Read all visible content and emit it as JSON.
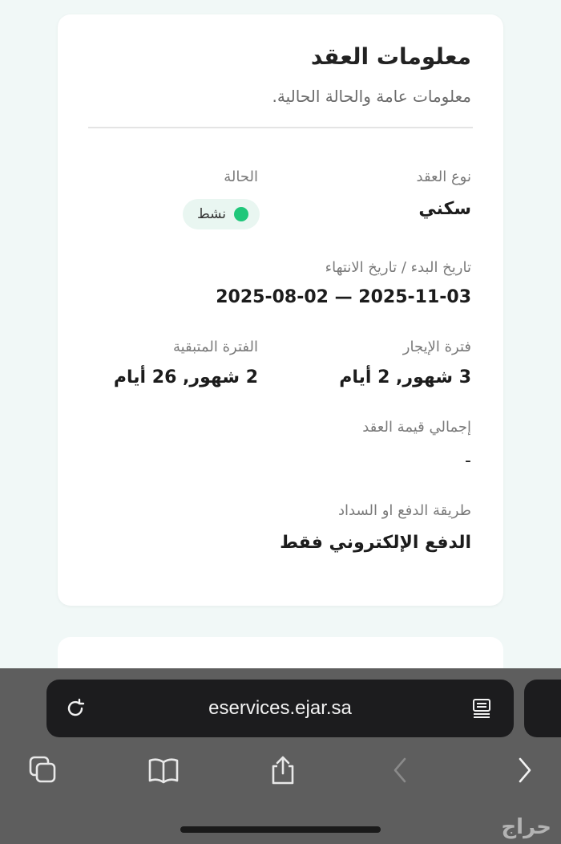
{
  "contract": {
    "title": "معلومات العقد",
    "subtitle": "معلومات عامة والحالة الحالية.",
    "contract_type_label": "نوع العقد",
    "contract_type_value": "سكني",
    "status_label": "الحالة",
    "status_value": "نشط",
    "dates_label": "تاريخ البدء / تاريخ الانتهاء",
    "dates_value": "2025-08-02 — 2025-11-03",
    "lease_period_label": "فترة الإيجار",
    "lease_period_value": "3 شهور, 2 أيام",
    "remaining_period_label": "الفترة المتبقية",
    "remaining_period_value": "2 شهور, 26 أيام",
    "total_value_label": "إجمالي قيمة العقد",
    "total_value_value": "-",
    "payment_method_label": "طريقة الدفع او السداد",
    "payment_method_value": "الدفع الإلكتروني فقط"
  },
  "browser": {
    "url": "eservices.ejar.sa"
  },
  "watermark": "حراج",
  "colors": {
    "status_active": "#1fc77a",
    "status_badge_bg": "#e9f6f1",
    "page_bg": "#f1f8f7"
  },
  "icons": {
    "reload": "reload-icon",
    "reader": "reader-mode-icon",
    "tabs": "tabs-icon",
    "bookmarks": "bookmarks-icon",
    "share": "share-icon",
    "back": "chevron-left-icon",
    "forward": "chevron-right-icon"
  }
}
